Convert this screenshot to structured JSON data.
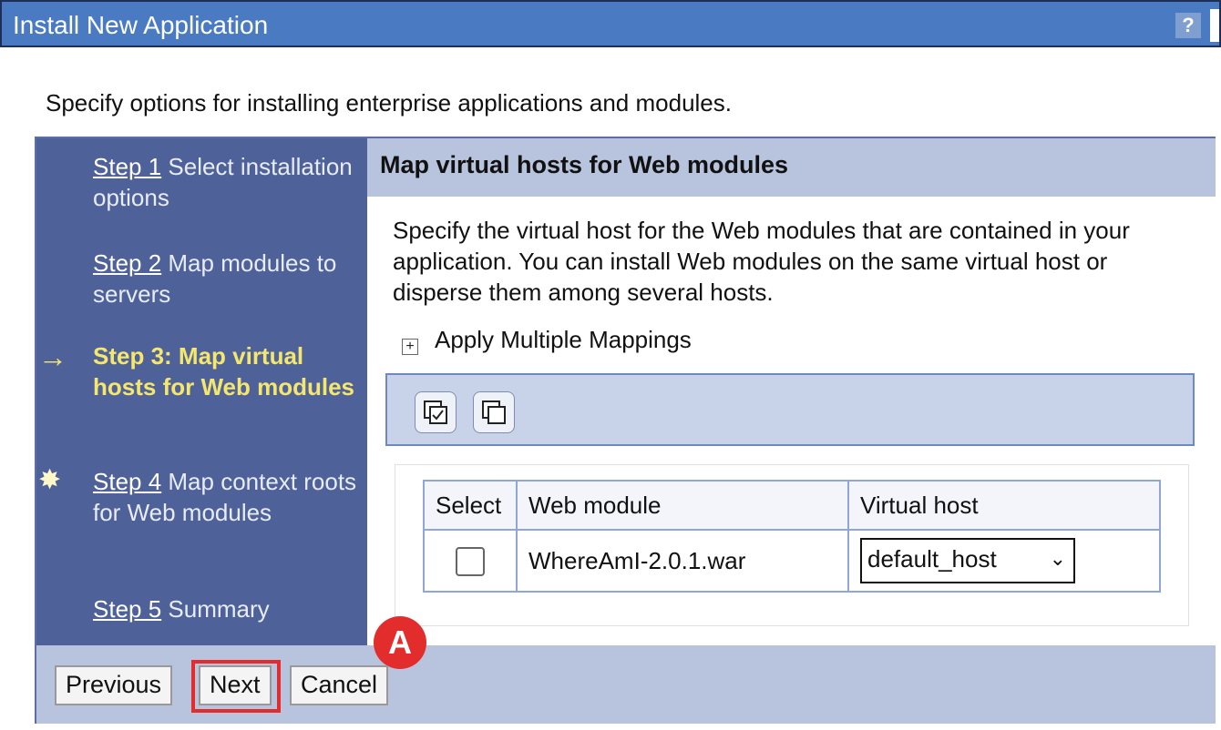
{
  "window": {
    "title": "Install New Application",
    "help_label": "?"
  },
  "intro": "Specify options for installing enterprise applications and modules.",
  "steps": [
    {
      "link": "Step 1",
      "text": " Select installation options"
    },
    {
      "link": "Step 2",
      "text": " Map modules to servers"
    },
    {
      "text": "Step 3: Map virtual hosts for Web modules"
    },
    {
      "link": "Step 4",
      "text": " Map context roots for Web modules"
    },
    {
      "link": "Step 5",
      "text": " Summary"
    }
  ],
  "content": {
    "heading": "Map virtual hosts for Web modules",
    "description": "Specify the virtual host for the Web modules that are contained in your application. You can install Web modules on the same virtual host or disperse them among several hosts.",
    "apply_multiple": "Apply Multiple Mappings",
    "table": {
      "headers": [
        "Select",
        "Web module",
        "Virtual host"
      ],
      "rows": [
        {
          "module": "WhereAmI-2.0.1.war",
          "virtual_host": "default_host"
        }
      ]
    }
  },
  "footer": {
    "previous": "Previous",
    "next": "Next",
    "cancel": "Cancel"
  },
  "annotation": {
    "marker": "A"
  },
  "colors": {
    "titlebar": "#4a7bc2",
    "nav": "#4e6299",
    "current_step": "#f5e66e",
    "highlight": "#e32c2c"
  }
}
